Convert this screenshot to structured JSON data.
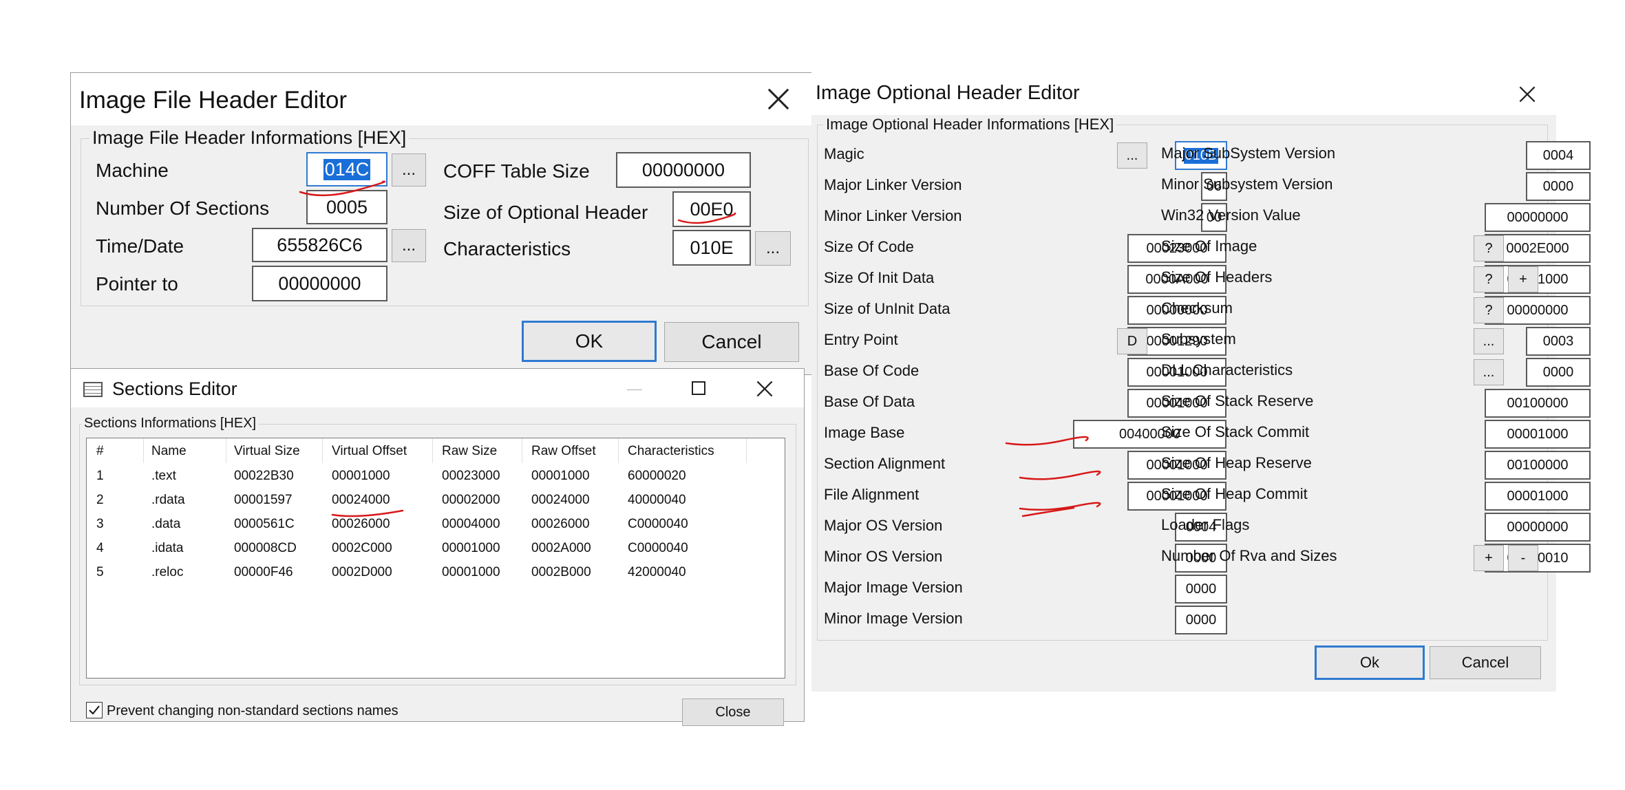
{
  "file_header_editor": {
    "title": "Image File Header Editor",
    "group_title": "Image File Header Informations [HEX]",
    "fields": {
      "machine": {
        "label": "Machine",
        "value": "014C"
      },
      "number_of_sections": {
        "label": "Number Of Sections",
        "value": "0005"
      },
      "time_date": {
        "label": "Time/Date",
        "value": "655826C6"
      },
      "pointer_to": {
        "label": "Pointer to",
        "value": "00000000"
      },
      "coff_table_size": {
        "label": "COFF Table Size",
        "value": "00000000"
      },
      "size_of_optional_header": {
        "label": "Size of Optional Header",
        "value": "00E0"
      },
      "characteristics": {
        "label": "Characteristics",
        "value": "010E"
      }
    },
    "ellipsis": "...",
    "ok_label": "OK",
    "cancel_label": "Cancel"
  },
  "sections_editor": {
    "title": "Sections Editor",
    "group_title": "Sections Informations [HEX]",
    "columns": [
      "#",
      "Name",
      "Virtual Size",
      "Virtual Offset",
      "Raw Size",
      "Raw Offset",
      "Characteristics"
    ],
    "rows": [
      [
        "1",
        ".text",
        "00022B30",
        "00001000",
        "00023000",
        "00001000",
        "60000020"
      ],
      [
        "2",
        ".rdata",
        "00001597",
        "00024000",
        "00002000",
        "00024000",
        "40000040"
      ],
      [
        "3",
        ".data",
        "0000561C",
        "00026000",
        "00004000",
        "00026000",
        "C0000040"
      ],
      [
        "4",
        ".idata",
        "000008CD",
        "0002C000",
        "00001000",
        "0002A000",
        "C0000040"
      ],
      [
        "5",
        ".reloc",
        "00000F46",
        "0002D000",
        "00001000",
        "0002B000",
        "42000040"
      ]
    ],
    "checkbox_label": "Prevent changing non-standard sections names",
    "checkbox_checked": true,
    "close_label": "Close"
  },
  "optional_header_editor": {
    "title": "Image Optional Header Editor",
    "group_title": "Image Optional Header Informations [HEX]",
    "left": [
      {
        "label": "Magic",
        "value": "010B"
      },
      {
        "label": "Major Linker Version",
        "value": "06"
      },
      {
        "label": "Minor Linker Version",
        "value": "00"
      },
      {
        "label": "Size Of Code",
        "value": "00023000"
      },
      {
        "label": "Size Of Init Data",
        "value": "0000A000"
      },
      {
        "label": "Size of UnInit Data",
        "value": "00000000"
      },
      {
        "label": "Entry Point",
        "value": "00001290"
      },
      {
        "label": "Base Of Code",
        "value": "00001000"
      },
      {
        "label": "Base Of Data",
        "value": "00001000"
      },
      {
        "label": "Image Base",
        "value": "00400000"
      },
      {
        "label": "Section Alignment",
        "value": "00001000"
      },
      {
        "label": "File Alignment",
        "value": "00001000"
      },
      {
        "label": "Major OS Version",
        "value": "0004"
      },
      {
        "label": "Minor OS Version",
        "value": "0000"
      },
      {
        "label": "Major Image Version",
        "value": "0000"
      },
      {
        "label": "Minor Image Version",
        "value": "0000"
      }
    ],
    "right": [
      {
        "label": "Major SubSystem Version",
        "value": "0004"
      },
      {
        "label": "Minor Subsystem Version",
        "value": "0000"
      },
      {
        "label": "Win32 Version Value",
        "value": "00000000"
      },
      {
        "label": "Size Of Image",
        "value": "0002E000"
      },
      {
        "label": "Size Of Headers",
        "value": "00001000"
      },
      {
        "label": "Checksum",
        "value": "00000000"
      },
      {
        "label": "Subsystem",
        "value": "0003"
      },
      {
        "label": "DLL Characteristics",
        "value": "0000"
      },
      {
        "label": "Size Of Stack Reserve",
        "value": "00100000"
      },
      {
        "label": "Size Of Stack Commit",
        "value": "00001000"
      },
      {
        "label": "Size Of Heap Reserve",
        "value": "00100000"
      },
      {
        "label": "Size Of Heap Commit",
        "value": "00001000"
      },
      {
        "label": "Loader Flags",
        "value": "00000000"
      },
      {
        "label": "Number Of Rva and Sizes",
        "value": "00000010"
      }
    ],
    "buttons": {
      "ellipsis": "...",
      "question": "?",
      "plus": "+",
      "minus": "-",
      "d": "D"
    },
    "ok_label": "Ok",
    "cancel_label": "Cancel"
  },
  "colors": {
    "annotation_red": "#d81818",
    "focus_blue": "#2f7ad1",
    "selection_blue": "#1a6ed8"
  }
}
